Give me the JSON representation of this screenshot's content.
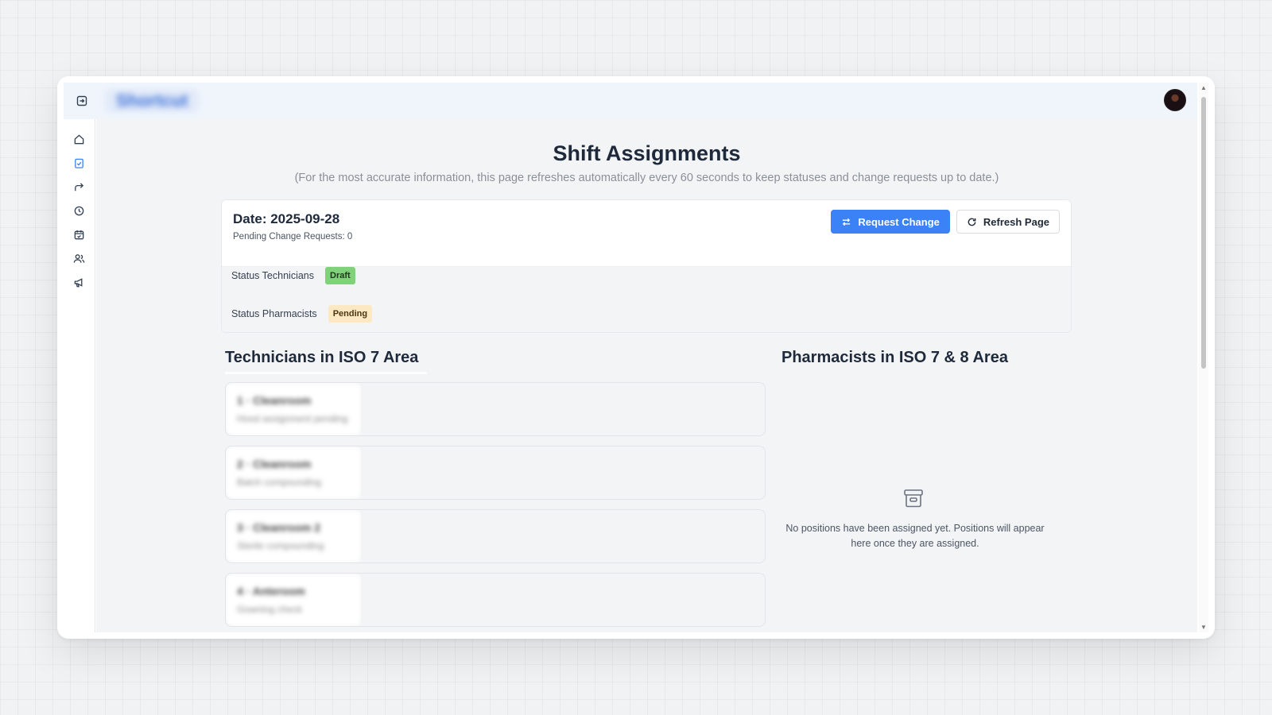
{
  "header": {
    "brand_name": "Shortcut",
    "toggle_icon": "sidebar-toggle-icon",
    "avatar_icon": "user-avatar"
  },
  "sidebar": {
    "items": [
      {
        "name": "home",
        "icon": "home-icon",
        "active": false
      },
      {
        "name": "assignments",
        "icon": "clipboard-check-icon",
        "active": true
      },
      {
        "name": "forward",
        "icon": "forward-arrow-icon",
        "active": false
      },
      {
        "name": "history",
        "icon": "clock-history-icon",
        "active": false
      },
      {
        "name": "calendar",
        "icon": "calendar-check-icon",
        "active": false
      },
      {
        "name": "users",
        "icon": "users-icon",
        "active": false
      },
      {
        "name": "announcements",
        "icon": "megaphone-icon",
        "active": false
      }
    ]
  },
  "main": {
    "title": "Shift Assignments",
    "subtitle": "(For the most accurate information, this page refreshes automatically every 60 seconds to keep statuses and change requests up to date.)",
    "card": {
      "date": "Date: 2025-09-28",
      "pending_requests": "Pending Change Requests: 0",
      "request_change_label": "Request Change",
      "refresh_label": "Refresh Page",
      "status_technicians_label": "Status Technicians",
      "status_technicians_value": "Draft",
      "status_pharmacists_label": "Status Pharmacists",
      "status_pharmacists_value": "Pending"
    },
    "technicians": {
      "title": "Technicians in ISO 7 Area",
      "items": [
        {
          "name": "1 · Cleanroom",
          "sub": "Hood assignment pending"
        },
        {
          "name": "2 · Cleanroom",
          "sub": "Batch compounding"
        },
        {
          "name": "3 · Cleanroom 2",
          "sub": "Sterile compounding"
        },
        {
          "name": "4 · Anteroom",
          "sub": "Gowning check"
        }
      ]
    },
    "pharmacists": {
      "title": "Pharmacists in ISO 7 & 8 Area",
      "empty_icon": "archive-box-icon",
      "empty_text": "No positions have been assigned yet. Positions will appear here once they are assigned."
    }
  },
  "fab": {
    "icon": "cloud-download-icon"
  },
  "colors": {
    "primary": "#3b82f6",
    "draft_badge": "#7fd17a",
    "pending_badge": "#fde8c4",
    "title_text": "#1e2a3b"
  }
}
